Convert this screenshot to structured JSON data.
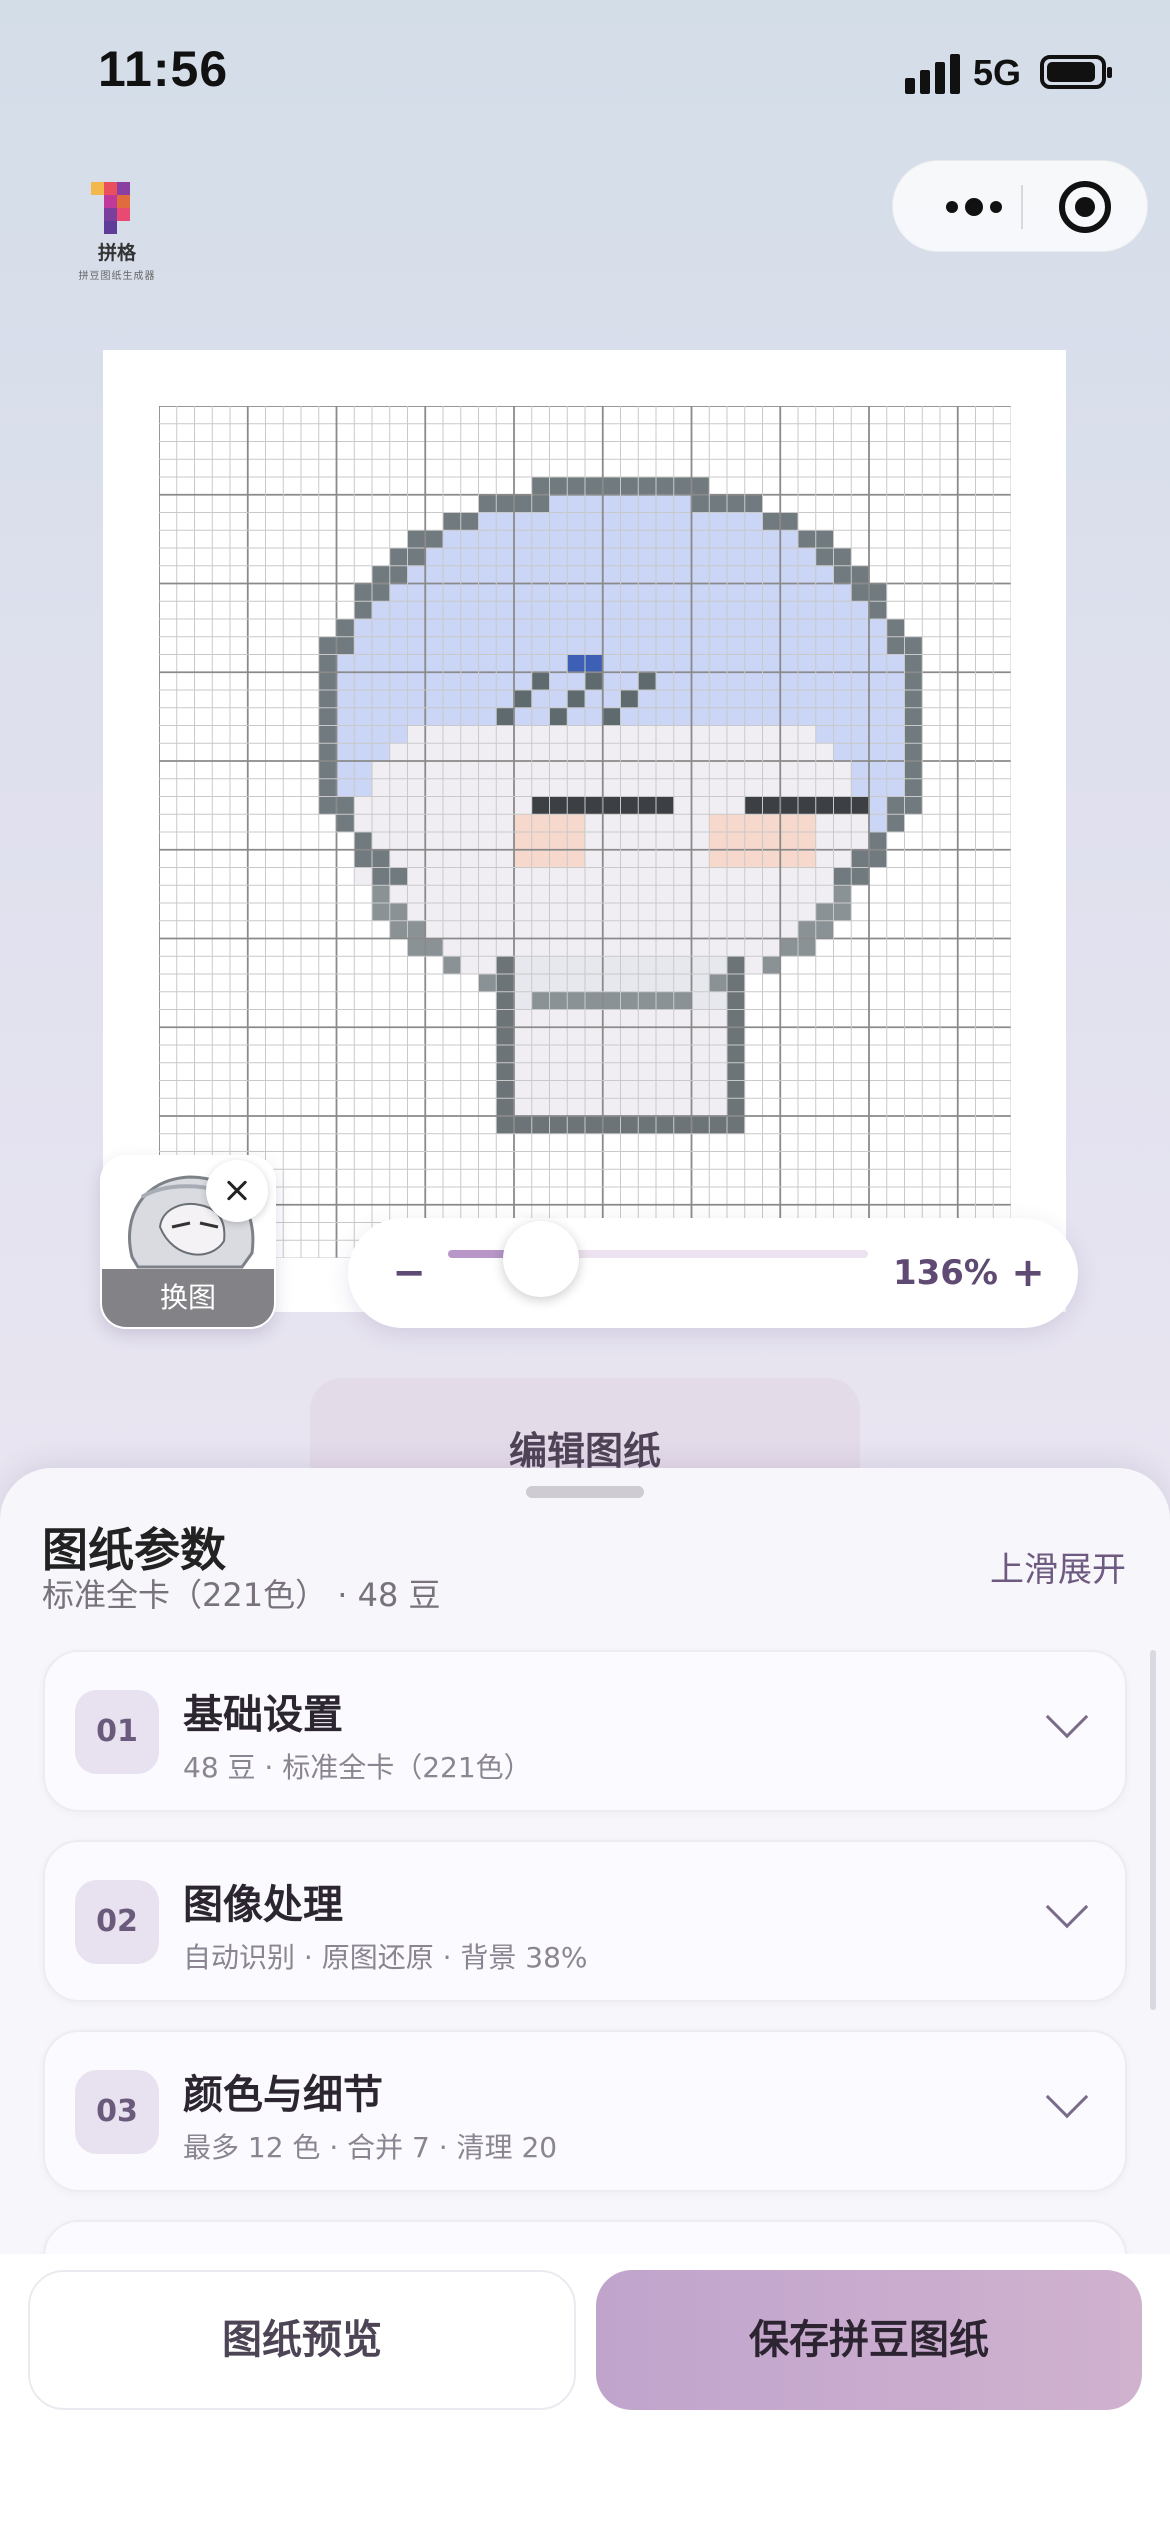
{
  "status_bar": {
    "time": "11:56",
    "network": "5G"
  },
  "logo": {
    "name": "拼格",
    "tagline": "拼豆图纸生成器"
  },
  "zoom": {
    "value_label": "136%",
    "minus_label": "−",
    "plus_label": "+",
    "level": 0.13
  },
  "swap": {
    "label": "换图"
  },
  "edit_button": {
    "label": "编辑图纸"
  },
  "sheet": {
    "title": "图纸参数",
    "subtitle": "标准全卡（221色） · 48 豆",
    "expand_label": "上滑展开",
    "sections": [
      {
        "num": "01",
        "title": "基础设置",
        "desc": "48 豆 · 标准全卡（221色）"
      },
      {
        "num": "02",
        "title": "图像处理",
        "desc": "自动识别 · 原图还原 · 背景 38%"
      },
      {
        "num": "03",
        "title": "颜色与细节",
        "desc": "最多 12 色 · 合并 7 · 清理 20"
      }
    ]
  },
  "footer": {
    "preview_label": "图纸预览",
    "save_label": "保存拼豆图纸"
  },
  "colors": {
    "accent": "#b896c8",
    "hair": "#cbd5f5",
    "outline": "#717a7f",
    "skin": "#f0eef3",
    "blush": "#f6d8cc"
  }
}
